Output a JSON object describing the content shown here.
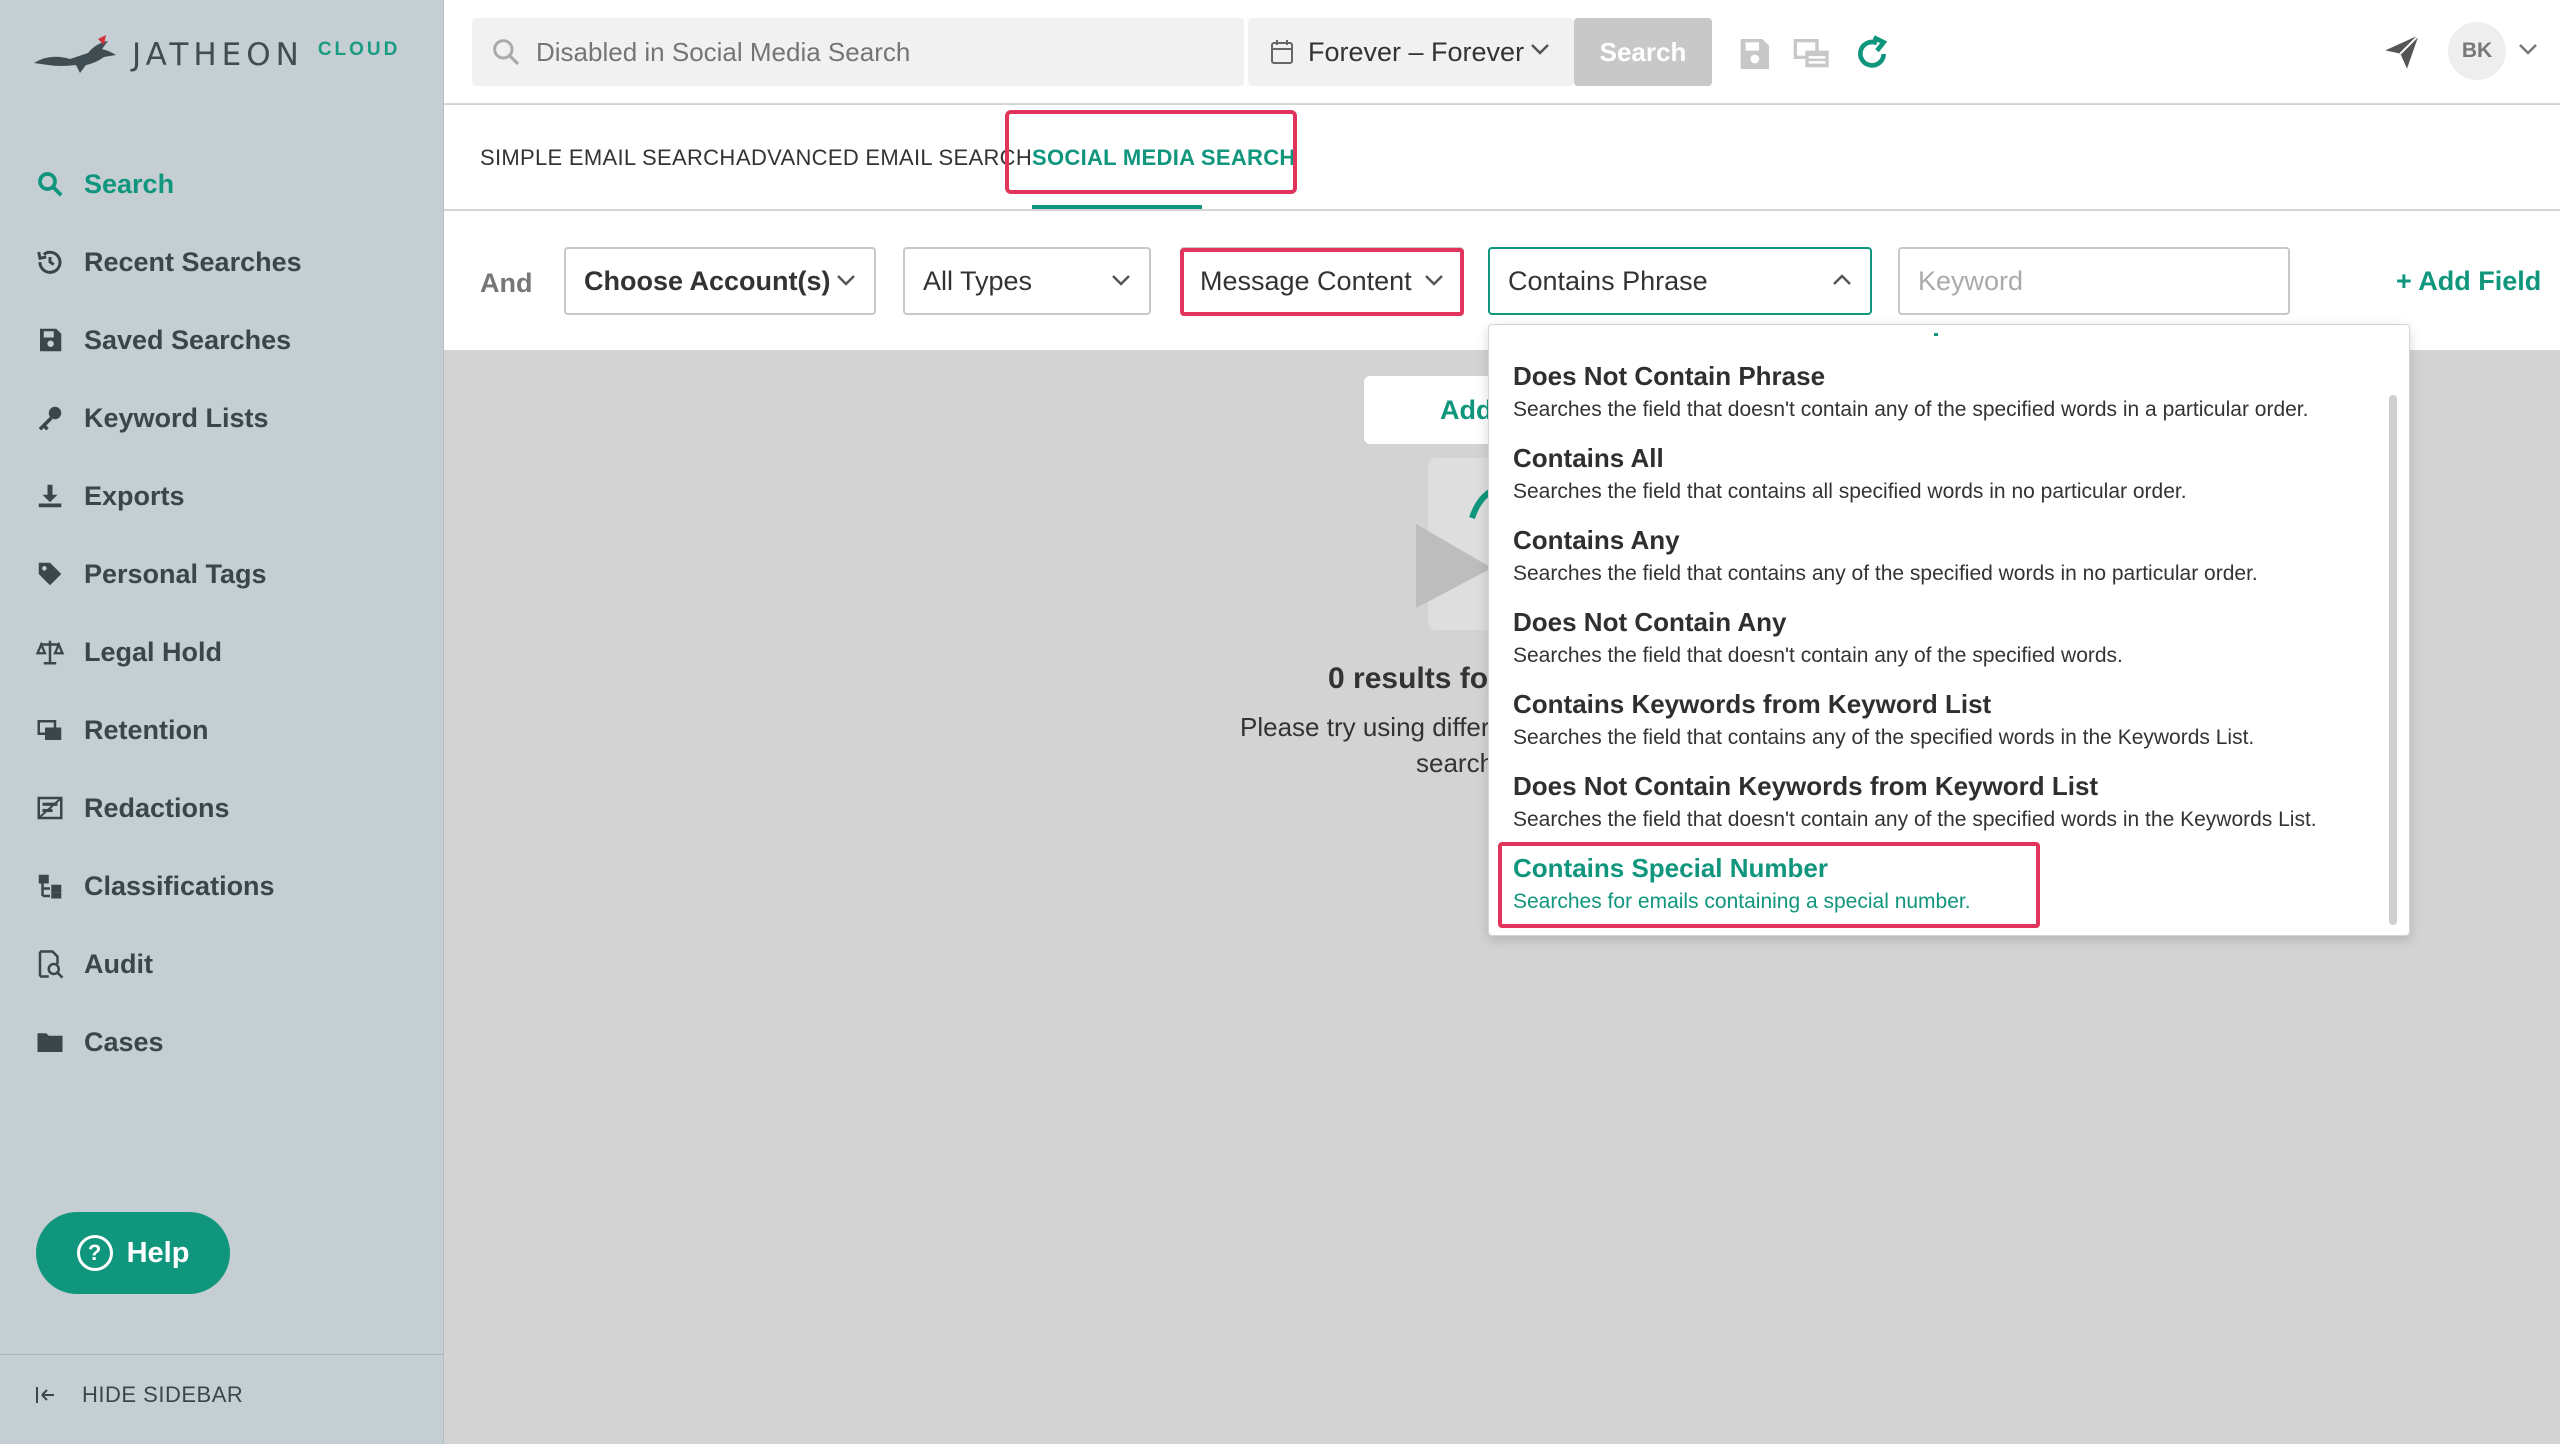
{
  "brand": {
    "name": "JATHEON",
    "suffix": "CLOUD"
  },
  "sidebar": {
    "items": [
      {
        "label": "Search",
        "icon": "search-icon",
        "active": true
      },
      {
        "label": "Recent Searches",
        "icon": "history-icon"
      },
      {
        "label": "Saved Searches",
        "icon": "save-icon"
      },
      {
        "label": "Keyword Lists",
        "icon": "key-icon"
      },
      {
        "label": "Exports",
        "icon": "download-icon"
      },
      {
        "label": "Personal Tags",
        "icon": "tag-icon"
      },
      {
        "label": "Legal Hold",
        "icon": "scale-icon"
      },
      {
        "label": "Retention",
        "icon": "retention-icon"
      },
      {
        "label": "Redactions",
        "icon": "redaction-icon"
      },
      {
        "label": "Classifications",
        "icon": "classification-icon"
      },
      {
        "label": "Audit",
        "icon": "audit-icon"
      },
      {
        "label": "Cases",
        "icon": "folder-icon"
      }
    ],
    "help_label": "Help",
    "hide_label": "HIDE SIDEBAR"
  },
  "topbar": {
    "search_placeholder": "Disabled in Social Media Search",
    "date_range": "Forever – Forever",
    "search_button": "Search",
    "avatar_initials": "BK"
  },
  "tabs": [
    {
      "label": "SIMPLE EMAIL SEARCH"
    },
    {
      "label": "ADVANCED EMAIL SEARCH"
    },
    {
      "label": "SOCIAL MEDIA SEARCH",
      "active": true
    }
  ],
  "filter": {
    "and_label": "And",
    "account_select": "Choose Account(s)",
    "type_select": "All Types",
    "field_select": "Message Content",
    "operator_select": "Contains Phrase",
    "keyword_placeholder": "Keyword",
    "add_field": "+ Add Field"
  },
  "dropdown": {
    "options": [
      {
        "title": "Does Not Contain Phrase",
        "desc": "Searches the field that doesn't contain any of the specified words in a particular order."
      },
      {
        "title": "Contains All",
        "desc": "Searches the field that contains all specified words in no particular order."
      },
      {
        "title": "Contains Any",
        "desc": "Searches the field that contains any of the specified words in no particular order."
      },
      {
        "title": "Does Not Contain Any",
        "desc": "Searches the field that doesn't contain any of the specified words."
      },
      {
        "title": "Contains Keywords from Keyword List",
        "desc": "Searches the field that contains any of the specified words in the Keywords List."
      },
      {
        "title": "Does Not Contain Keywords from Keyword List",
        "desc": "Searches the field that doesn't contain any of the specified words in the Keywords List."
      },
      {
        "title": "Contains Special Number",
        "desc": "Searches for emails containing a special number."
      }
    ]
  },
  "empty_state": {
    "add_button": "Add",
    "title": "0 results fou",
    "line1": "Please try using differ",
    "line2": "search"
  },
  "colors": {
    "accent": "#11967e",
    "highlight": "#e0345c",
    "sidebar_bg": "#c5cfd3"
  }
}
